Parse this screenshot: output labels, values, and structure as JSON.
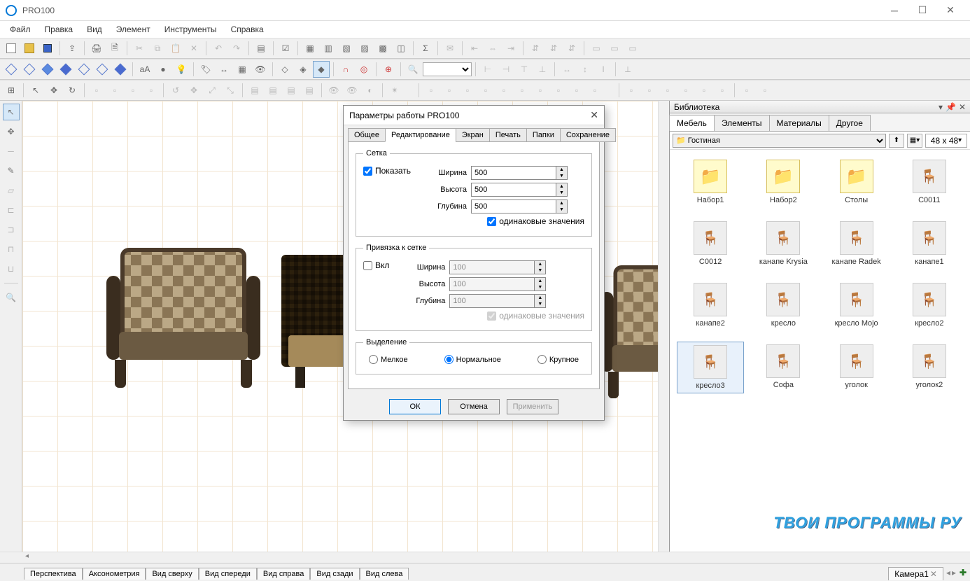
{
  "window": {
    "title": "PRO100"
  },
  "menu": [
    "Файл",
    "Правка",
    "Вид",
    "Элемент",
    "Инструменты",
    "Справка"
  ],
  "view_tabs": [
    "Перспектива",
    "Аксонометрия",
    "Вид сверху",
    "Вид спереди",
    "Вид справа",
    "Вид сзади",
    "Вид слева"
  ],
  "camera_tab": "Камера1",
  "library": {
    "title": "Библиотека",
    "tabs": [
      "Мебель",
      "Элементы",
      "Материалы",
      "Другое"
    ],
    "active_tab": 0,
    "folder": "Гостиная",
    "thumb_size": "48 x 48",
    "items": [
      {
        "label": "Набор1",
        "type": "folder"
      },
      {
        "label": "Набор2",
        "type": "folder"
      },
      {
        "label": "Столы",
        "type": "folder"
      },
      {
        "label": "C0011",
        "type": "obj"
      },
      {
        "label": "C0012",
        "type": "obj"
      },
      {
        "label": "канапе Krysia",
        "type": "obj"
      },
      {
        "label": "канапе Radek",
        "type": "obj"
      },
      {
        "label": "канапе1",
        "type": "obj"
      },
      {
        "label": "канапе2",
        "type": "obj"
      },
      {
        "label": "кресло",
        "type": "obj"
      },
      {
        "label": "кресло Mojo",
        "type": "obj"
      },
      {
        "label": "кресло2",
        "type": "obj"
      },
      {
        "label": "кресло3",
        "type": "obj",
        "selected": true
      },
      {
        "label": "Софа",
        "type": "obj"
      },
      {
        "label": "уголок",
        "type": "obj"
      },
      {
        "label": "уголок2",
        "type": "obj"
      }
    ]
  },
  "dialog": {
    "title": "Параметры работы PRO100",
    "tabs": [
      "Общее",
      "Редактирование",
      "Экран",
      "Печать",
      "Папки",
      "Сохранение"
    ],
    "active_tab": 1,
    "grid": {
      "legend": "Сетка",
      "show_label": "Показать",
      "show": true,
      "width_label": "Ширина",
      "width": "500",
      "height_label": "Высота",
      "height": "500",
      "depth_label": "Глубина",
      "depth": "500",
      "equal_label": "одинаковые значения",
      "equal": true
    },
    "snap": {
      "legend": "Привязка к сетке",
      "on_label": "Вкл",
      "on": false,
      "width_label": "Ширина",
      "width": "100",
      "height_label": "Высота",
      "height": "100",
      "depth_label": "Глубина",
      "depth": "100",
      "equal_label": "одинаковые значения",
      "equal": true
    },
    "selection": {
      "legend": "Выделение",
      "options": [
        "Мелкое",
        "Нормальное",
        "Крупное"
      ],
      "value": "Нормальное"
    },
    "buttons": {
      "ok": "ОК",
      "cancel": "Отмена",
      "apply": "Применить"
    }
  },
  "watermark": "ТВОИ ПРОГРАММЫ РУ"
}
